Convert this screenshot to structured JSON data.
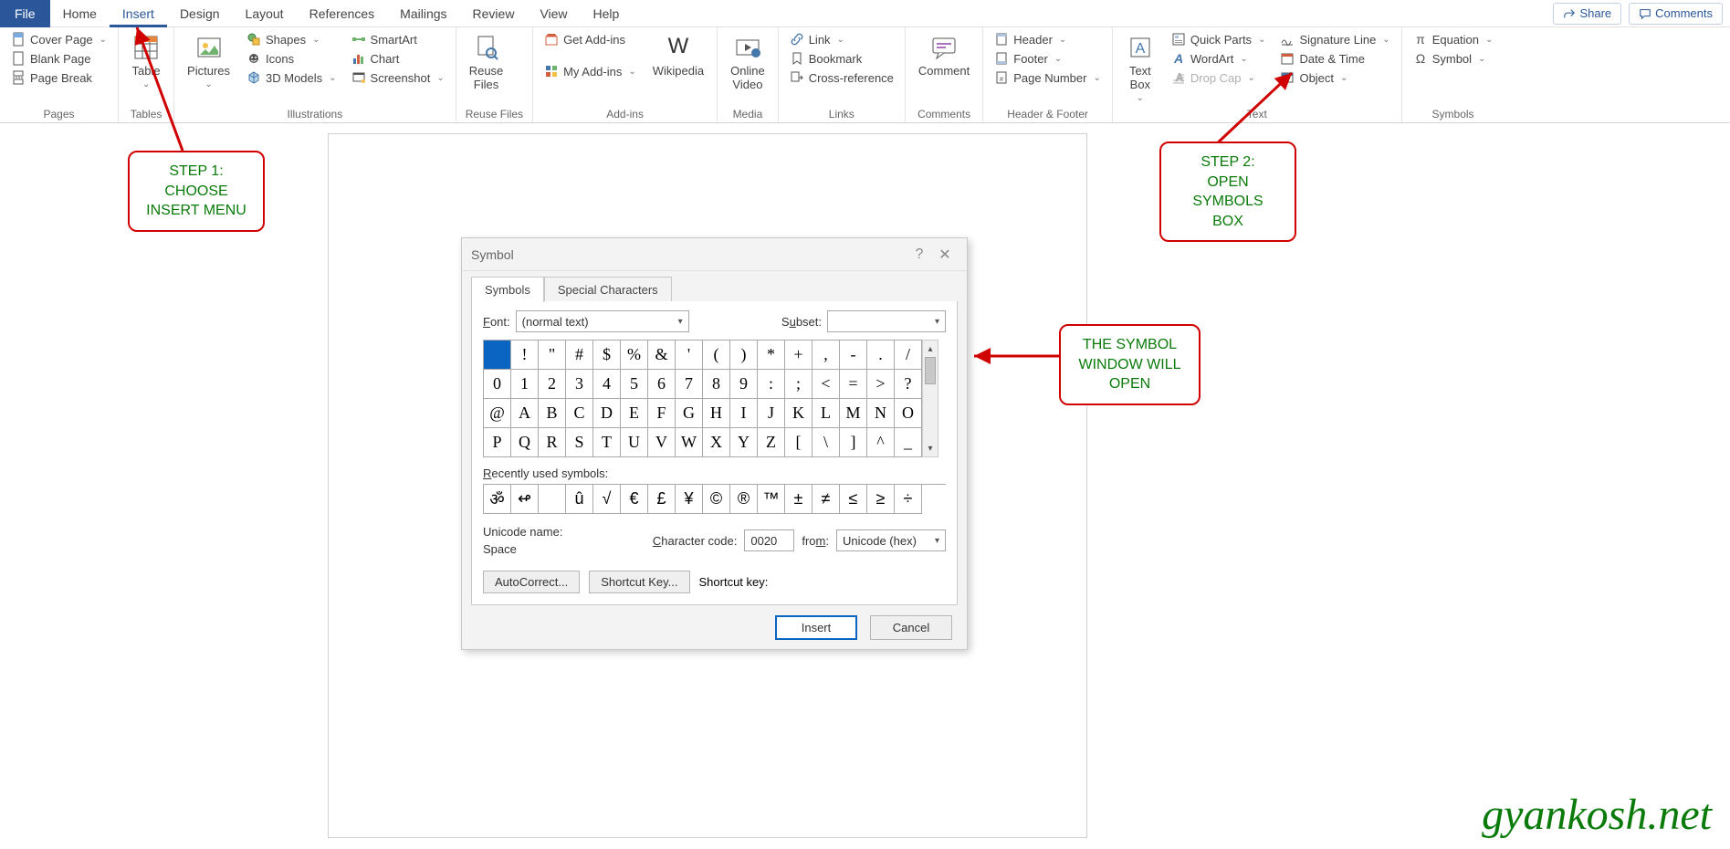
{
  "menus": {
    "file": "File",
    "home": "Home",
    "insert": "Insert",
    "design": "Design",
    "layout": "Layout",
    "references": "References",
    "mailings": "Mailings",
    "review": "Review",
    "view": "View",
    "help": "Help"
  },
  "topRight": {
    "share": "Share",
    "comments": "Comments"
  },
  "ribbon": {
    "pages": {
      "cover": "Cover Page",
      "blank": "Blank Page",
      "break": "Page Break",
      "label": "Pages"
    },
    "tables": {
      "table": "Table",
      "label": "Tables"
    },
    "illus": {
      "pictures": "Pictures",
      "shapes": "Shapes",
      "icons": "Icons",
      "models": "3D Models",
      "smartart": "SmartArt",
      "chart": "Chart",
      "screenshot": "Screenshot",
      "label": "Illustrations"
    },
    "reuse": {
      "reuse": "Reuse\nFiles",
      "label": "Reuse Files"
    },
    "addins": {
      "get": "Get Add-ins",
      "my": "My Add-ins",
      "wiki": "Wikipedia",
      "label": "Add-ins"
    },
    "media": {
      "online": "Online\nVideo",
      "label": "Media"
    },
    "links": {
      "link": "Link",
      "bookmark": "Bookmark",
      "crossref": "Cross-reference",
      "label": "Links"
    },
    "comments": {
      "comment": "Comment",
      "label": "Comments"
    },
    "hf": {
      "header": "Header",
      "footer": "Footer",
      "pagenum": "Page Number",
      "label": "Header & Footer"
    },
    "text": {
      "textbox": "Text\nBox",
      "quick": "Quick Parts",
      "wordart": "WordArt",
      "dropcap": "Drop Cap",
      "sig": "Signature Line",
      "date": "Date & Time",
      "object": "Object",
      "label": "Text"
    },
    "symbols": {
      "equation": "Equation",
      "symbol": "Symbol",
      "label": "Symbols"
    }
  },
  "callouts": {
    "step1_a": "STEP 1:",
    "step1_b": "CHOOSE",
    "step1_c": "INSERT MENU",
    "step2_a": "STEP 2:",
    "step2_b": "OPEN SYMBOLS",
    "step2_c": "BOX",
    "open_a": "THE SYMBOL",
    "open_b": "WINDOW WILL",
    "open_c": "OPEN"
  },
  "dialog": {
    "title": "Symbol",
    "tab_symbols": "Symbols",
    "tab_special": "Special Characters",
    "font_lbl": "Font:",
    "font_val": "(normal text)",
    "subset_lbl": "Subset:",
    "subset_val": "",
    "rows": [
      [
        "",
        "!",
        "\"",
        "#",
        "$",
        "%",
        "&",
        "'",
        "(",
        ")",
        "*",
        "+",
        ",",
        "-",
        ".",
        "/"
      ],
      [
        "0",
        "1",
        "2",
        "3",
        "4",
        "5",
        "6",
        "7",
        "8",
        "9",
        ":",
        ";",
        "<",
        "=",
        ">",
        "?"
      ],
      [
        "@",
        "A",
        "B",
        "C",
        "D",
        "E",
        "F",
        "G",
        "H",
        "I",
        "J",
        "K",
        "L",
        "M",
        "N",
        "O"
      ],
      [
        "P",
        "Q",
        "R",
        "S",
        "T",
        "U",
        "V",
        "W",
        "X",
        "Y",
        "Z",
        "[",
        "\\",
        "]",
        "^",
        "_"
      ]
    ],
    "recent_lbl": "Recently used symbols:",
    "recent": [
      "ॐ",
      "↫",
      "",
      "û",
      "√",
      "€",
      "£",
      "¥",
      "©",
      "®",
      "™",
      "±",
      "≠",
      "≤",
      "≥",
      "÷"
    ],
    "uni_lbl": "Unicode name:",
    "uni_val": "Space",
    "code_lbl": "Character code:",
    "code_val": "0020",
    "from_lbl": "from:",
    "from_val": "Unicode (hex)",
    "autocorrect": "AutoCorrect...",
    "shortcut": "Shortcut Key...",
    "shortcut_lbl": "Shortcut key:",
    "insert": "Insert",
    "cancel": "Cancel"
  },
  "watermark": "gyankosh.net"
}
